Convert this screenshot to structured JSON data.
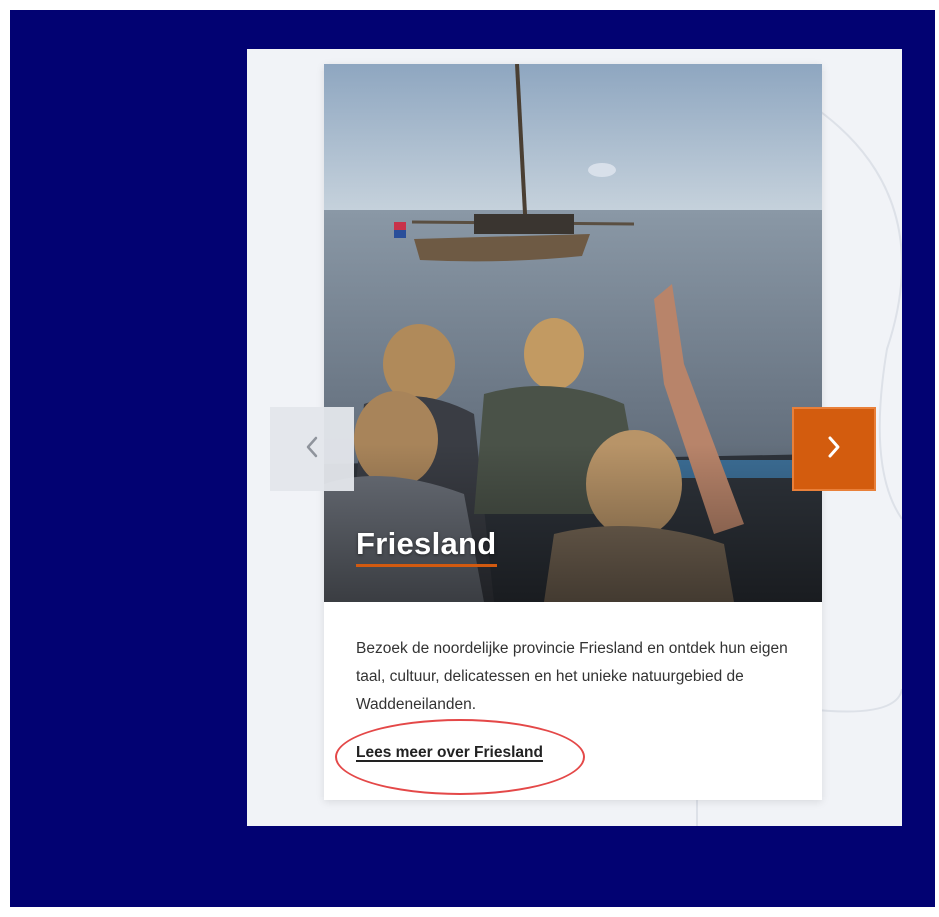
{
  "carousel": {
    "card": {
      "title": "Friesland",
      "description": "Bezoek de noordelijke provincie Friesland en ontdek hun eigen taal, cultuur, delicatessen en het unieke natuurgebied de Waddeneilanden.",
      "link_label": "Lees meer over Friesland",
      "image": "photo-people-waving-at-sailboat"
    },
    "prev_icon": "chevron-left-icon",
    "next_icon": "chevron-right-icon"
  },
  "colors": {
    "frame_background": "#020272",
    "panel_background": "#f1f3f7",
    "accent_orange": "#d35c0e",
    "annotation_red": "#e44848"
  }
}
